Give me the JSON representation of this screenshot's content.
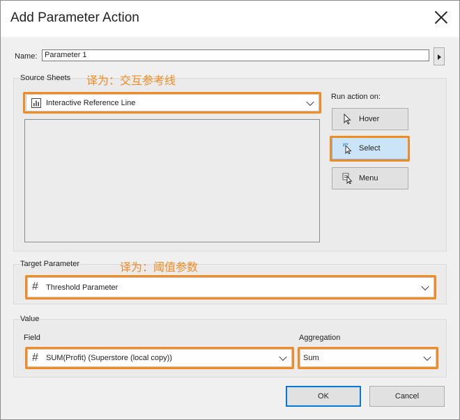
{
  "dialog": {
    "title": "Add Parameter Action"
  },
  "name": {
    "label": "Name:",
    "value": "Parameter 1"
  },
  "source_sheets": {
    "label": "Source Sheets",
    "annotation": "译为：交互参考线",
    "selected": "Interactive Reference Line",
    "icon": "bar-chart-icon"
  },
  "run_action": {
    "label": "Run action on:",
    "options": [
      {
        "label": "Hover",
        "icon": "cursor-arrow-icon",
        "selected": false
      },
      {
        "label": "Select",
        "icon": "cursor-click-icon",
        "selected": true
      },
      {
        "label": "Menu",
        "icon": "cursor-menu-icon",
        "selected": false
      }
    ]
  },
  "target_parameter": {
    "label": "Target Parameter",
    "annotation": "译为：阈值参数",
    "selected": "Threshold Parameter",
    "icon": "hash-icon"
  },
  "value": {
    "label": "Value",
    "field": {
      "label": "Field",
      "selected": "SUM(Profit) (Superstore (local copy))",
      "icon": "hash-icon"
    },
    "aggregation": {
      "label": "Aggregation",
      "selected": "Sum"
    }
  },
  "buttons": {
    "ok": "OK",
    "cancel": "Cancel"
  },
  "colors": {
    "highlight": "#f28b22",
    "selected_button": "#cce4f7",
    "primary_border": "#0078d7"
  }
}
